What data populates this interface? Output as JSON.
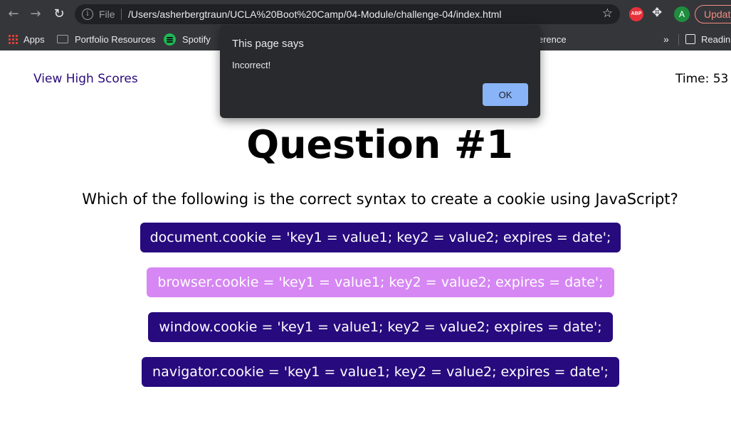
{
  "browser": {
    "address_prefix": "File",
    "url": "/Users/asherbergtraun/UCLA%20Boot%20Camp/04-Module/challenge-04/index.html",
    "extension_badge": "ABP",
    "profile_initial": "A",
    "update_label": "Updat",
    "bookmarks": {
      "apps": "Apps",
      "portfolio": "Portfolio Resources",
      "spotify": "Spotify",
      "reference": "eference",
      "more": "»",
      "reading": "Readin"
    }
  },
  "page": {
    "high_scores_link": "View High Scores",
    "timer": "Time: 53",
    "question_title": "Question #1",
    "question_text": "Which of the following is the correct syntax to create a cookie using JavaScript?",
    "answers": [
      "document.cookie = 'key1 = value1; key2 = value2; expires = date';",
      "browser.cookie = 'key1 = value1; key2 = value2; expires = date';",
      "window.cookie = 'key1 = value1; key2 = value2; expires = date';",
      "navigator.cookie = 'key1 = value1; key2 = value2; expires = date';"
    ],
    "answer_color": "#270a7e",
    "selected_answer_color": "#d687f3"
  },
  "dialog": {
    "title": "This page says",
    "message": "Incorrect!",
    "ok_label": "OK"
  }
}
